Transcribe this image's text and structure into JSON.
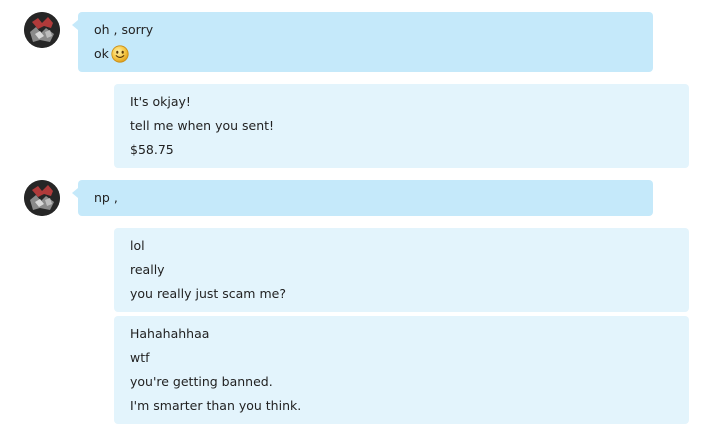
{
  "messages": [
    {
      "direction": "incoming",
      "lines": [
        "oh , sorry",
        "ok"
      ],
      "emoji": "smile-emoji"
    },
    {
      "direction": "outgoing",
      "lines": [
        "It's okjay!",
        "tell me when you sent!",
        "$58.75"
      ]
    },
    {
      "direction": "incoming",
      "lines": [
        "np ,"
      ]
    },
    {
      "direction": "outgoing",
      "lines": [
        "lol",
        "really",
        "you really just scam me?"
      ]
    },
    {
      "direction": "outgoing",
      "lines": [
        "Hahahahhaa",
        "wtf",
        "you're getting banned.",
        "I'm smarter than you think."
      ]
    }
  ],
  "colors": {
    "incoming_bubble": "#c5e9fa",
    "outgoing_bubble": "#e3f4fc",
    "text": "#222222"
  },
  "icons": {
    "avatar": "contact-avatar-icon",
    "emoji": "smile-emoji-icon"
  }
}
